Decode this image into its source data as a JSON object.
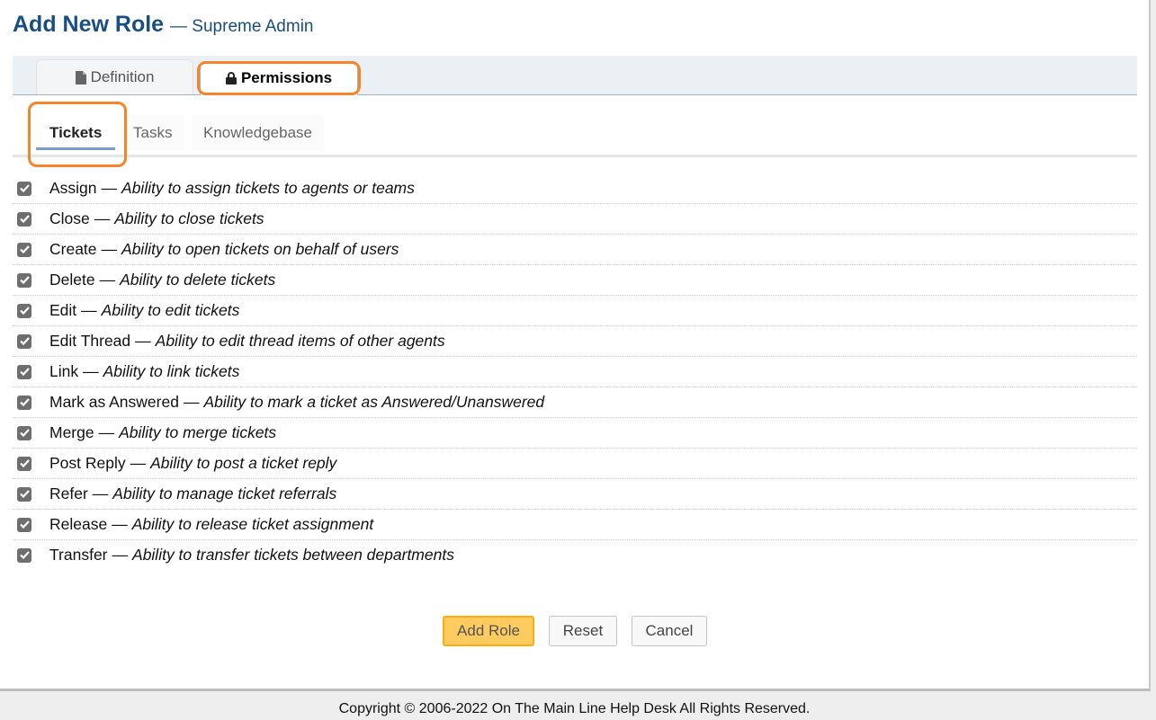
{
  "header": {
    "title": "Add New Role",
    "subtitle": "— Supreme Admin"
  },
  "tabs": [
    {
      "label": "Definition",
      "icon": "file-icon",
      "active": false
    },
    {
      "label": "Permissions",
      "icon": "lock-icon",
      "active": true
    }
  ],
  "subtabs": [
    {
      "label": "Tickets",
      "active": true
    },
    {
      "label": "Tasks",
      "active": false
    },
    {
      "label": "Knowledgebase",
      "active": false
    }
  ],
  "permissions": [
    {
      "name": "Assign",
      "description": "Ability to assign tickets to agents or teams",
      "checked": true
    },
    {
      "name": "Close",
      "description": "Ability to close tickets",
      "checked": true
    },
    {
      "name": "Create",
      "description": "Ability to open tickets on behalf of users",
      "checked": true
    },
    {
      "name": "Delete",
      "description": "Ability to delete tickets",
      "checked": true
    },
    {
      "name": "Edit",
      "description": "Ability to edit tickets",
      "checked": true
    },
    {
      "name": "Edit Thread",
      "description": "Ability to edit thread items of other agents",
      "checked": true
    },
    {
      "name": "Link",
      "description": "Ability to link tickets",
      "checked": true
    },
    {
      "name": "Mark as Answered",
      "description": "Ability to mark a ticket as Answered/Unanswered",
      "checked": true
    },
    {
      "name": "Merge",
      "description": "Ability to merge tickets",
      "checked": true
    },
    {
      "name": "Post Reply",
      "description": "Ability to post a ticket reply",
      "checked": true
    },
    {
      "name": "Refer",
      "description": "Ability to manage ticket referrals",
      "checked": true
    },
    {
      "name": "Release",
      "description": "Ability to release ticket assignment",
      "checked": true
    },
    {
      "name": "Transfer",
      "description": "Ability to transfer tickets between departments",
      "checked": true
    }
  ],
  "separator": "—",
  "buttons": {
    "submit": "Add Role",
    "reset": "Reset",
    "cancel": "Cancel"
  },
  "footer": {
    "copyright": "Copyright © 2006-2022 On The Main Line Help Desk All Rights Reserved."
  },
  "colors": {
    "title": "#184e81",
    "highlight": "#f5842a",
    "primary_button": "#fdcb5f",
    "active_subtab_underline": "#7b9cc8"
  }
}
